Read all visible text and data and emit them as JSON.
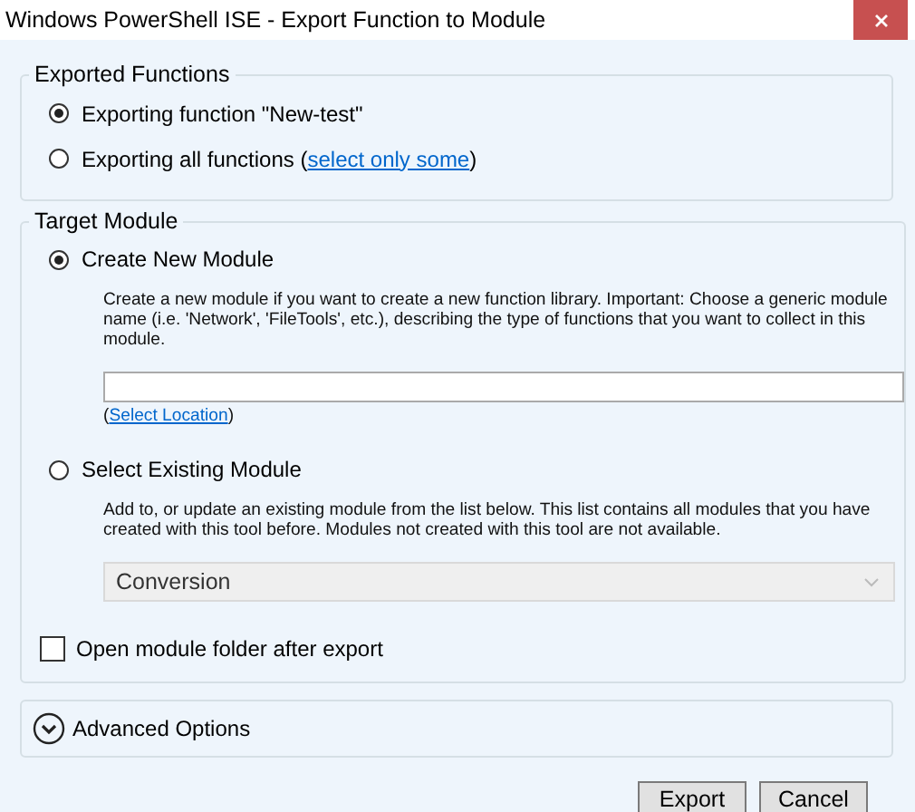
{
  "window": {
    "title": "Windows PowerShell ISE - Export Function to Module"
  },
  "exported_functions": {
    "title": "Exported Functions",
    "options": [
      {
        "label": "Exporting function \"New-test\"",
        "selected": true
      },
      {
        "label": "Exporting all functions (",
        "link": "select only some",
        "suffix": ")",
        "selected": false
      }
    ]
  },
  "target_module": {
    "title": "Target Module",
    "options": [
      {
        "kind": "new",
        "label": "Create New Module",
        "selected": true,
        "description": "Create a new module if you want to create a new function library. Important: Choose a generic module name (i.e. 'Network', 'FileTools', etc.), describing the type of functions that you want to collect in this module.",
        "location_prefix": "(",
        "location_link": "Select Location",
        "location_suffix": ")"
      },
      {
        "kind": "existing",
        "label": "Select Existing Module",
        "selected": false,
        "description": "Add to, or update an existing module from the list below. This list contains all modules that you have created with this tool before. Modules not created with this tool are not available.",
        "dropdown": {
          "value": "Conversion",
          "disabled": true
        }
      }
    ],
    "open_folder": {
      "label": "Open module folder after export",
      "checked": false
    }
  },
  "advanced": {
    "label": "Advanced Options",
    "expanded": false
  },
  "buttons": [
    "Export",
    "Cancel"
  ]
}
